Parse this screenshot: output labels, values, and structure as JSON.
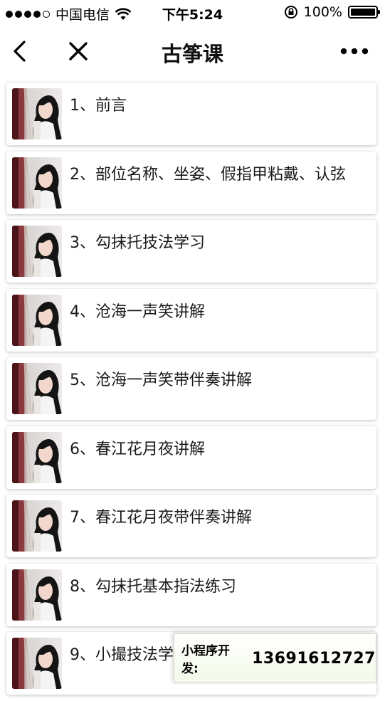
{
  "status_bar": {
    "carrier": "中国电信",
    "time": "下午5:24",
    "battery": "100%"
  },
  "nav": {
    "title": "古筝课",
    "back_icon": "chevron-left-icon",
    "close_icon": "close-icon",
    "more_icon": "more-icon"
  },
  "lessons": [
    {
      "title": "1、前言"
    },
    {
      "title": "2、部位名称、坐姿、假指甲粘戴、认弦"
    },
    {
      "title": "3、勾抹托技法学习"
    },
    {
      "title": "4、沧海一声笑讲解"
    },
    {
      "title": "5、沧海一声笑带伴奏讲解"
    },
    {
      "title": "6、春江花月夜讲解"
    },
    {
      "title": "7、春江花月夜带伴奏讲解"
    },
    {
      "title": "8、勾抹托基本指法练习"
    },
    {
      "title": "9、小撮技法学习"
    }
  ],
  "promo": {
    "label": "小程序开发:",
    "phone": "13691612727"
  }
}
